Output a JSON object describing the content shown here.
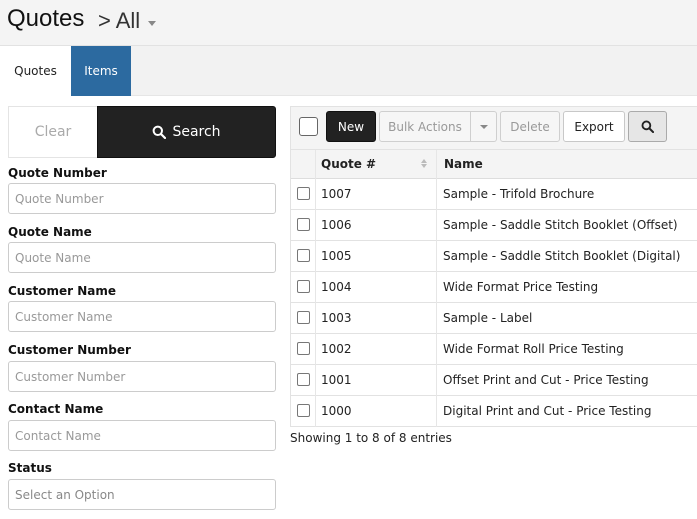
{
  "header": {
    "title": "Quotes",
    "breadcrumb": "> All"
  },
  "tabs": [
    {
      "label": "Quotes"
    },
    {
      "label": "Items"
    }
  ],
  "filters": {
    "clear_label": "Clear",
    "search_label": "Search",
    "fields": [
      {
        "label": "Quote Number",
        "placeholder": "Quote Number"
      },
      {
        "label": "Quote Name",
        "placeholder": "Quote Name"
      },
      {
        "label": "Customer Name",
        "placeholder": "Customer Name"
      },
      {
        "label": "Customer Number",
        "placeholder": "Customer Number"
      },
      {
        "label": "Contact Name",
        "placeholder": "Contact Name"
      }
    ],
    "status": {
      "label": "Status",
      "selected": "Select an Option"
    }
  },
  "toolbar": {
    "new_label": "New",
    "bulk_label": "Bulk Actions",
    "delete_label": "Delete",
    "export_label": "Export"
  },
  "table": {
    "columns": [
      "Quote #",
      "Name"
    ],
    "rows": [
      {
        "num": "1007",
        "name": "Sample - Trifold Brochure"
      },
      {
        "num": "1006",
        "name": "Sample - Saddle Stitch Booklet (Offset)"
      },
      {
        "num": "1005",
        "name": "Sample - Saddle Stitch Booklet (Digital)"
      },
      {
        "num": "1004",
        "name": "Wide Format Price Testing"
      },
      {
        "num": "1003",
        "name": "Sample - Label"
      },
      {
        "num": "1002",
        "name": "Wide Format Roll Price Testing"
      },
      {
        "num": "1001",
        "name": "Offset Print and Cut - Price Testing"
      },
      {
        "num": "1000",
        "name": "Digital Print and Cut - Price Testing"
      }
    ],
    "footer": "Showing 1 to 8 of 8 entries"
  }
}
